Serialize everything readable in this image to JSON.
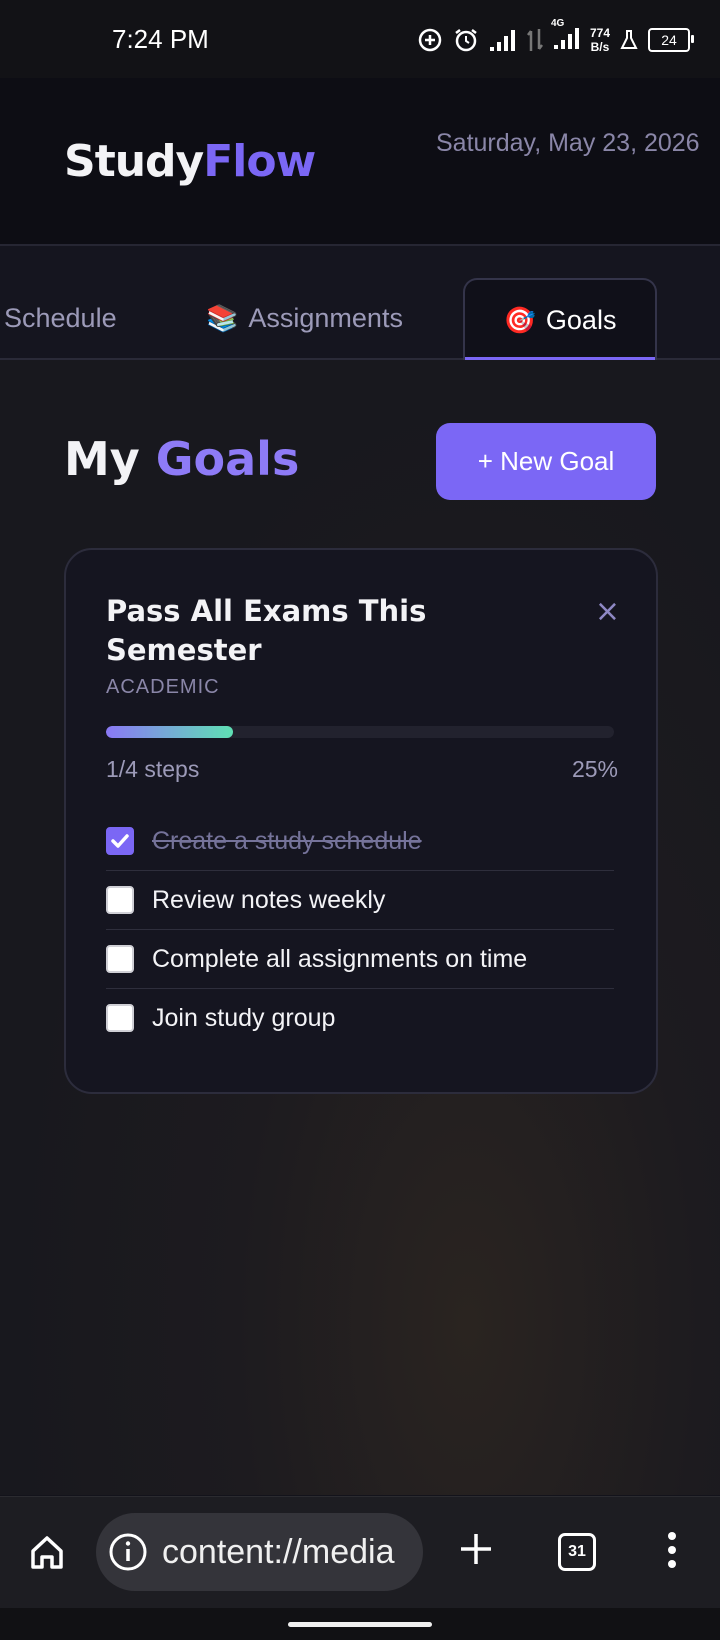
{
  "status_bar": {
    "time": "7:24 PM",
    "net_top": "774",
    "net_bottom": "B/s",
    "net_type": "4G",
    "battery": "24",
    "icons": [
      "add-circle-icon",
      "alarm-icon",
      "signal-icon",
      "data-arrows-icon",
      "signal-4g-icon",
      "lab-flask-icon",
      "battery-icon"
    ]
  },
  "header": {
    "logo_part1": "Study",
    "logo_part2": "Flow",
    "date": "Saturday, May 23, 2026"
  },
  "tabs": [
    {
      "label": "Schedule",
      "emoji": "",
      "active": false
    },
    {
      "label": "Assignments",
      "emoji": "📚",
      "active": false
    },
    {
      "label": "Goals",
      "emoji": "🎯",
      "active": true
    }
  ],
  "page": {
    "title_part1": "My",
    "title_part2": "Goals",
    "new_goal_label": "+ New Goal"
  },
  "goal": {
    "title": "Pass All Exams This Semester",
    "category": "ACADEMIC",
    "close_symbol": "×",
    "progress_label": "1/4 steps",
    "progress_percent": "25%",
    "progress_value": 0.25,
    "steps": [
      {
        "label": "Create a study schedule",
        "done": true
      },
      {
        "label": "Review notes weekly",
        "done": false
      },
      {
        "label": "Complete all assignments on time",
        "done": false
      },
      {
        "label": "Join study group",
        "done": false
      }
    ]
  },
  "browser": {
    "url": "content://media",
    "tab_count": "31"
  },
  "colors": {
    "accent": "#7b67f5",
    "progress_start": "#8a78f5",
    "progress_end": "#5fe0b4"
  }
}
